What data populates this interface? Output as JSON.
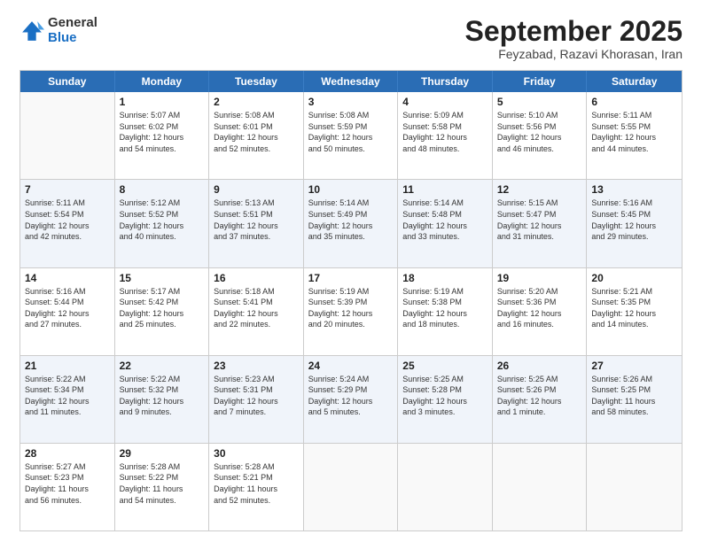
{
  "logo": {
    "general": "General",
    "blue": "Blue"
  },
  "title": "September 2025",
  "location": "Feyzabad, Razavi Khorasan, Iran",
  "header": {
    "days": [
      "Sunday",
      "Monday",
      "Tuesday",
      "Wednesday",
      "Thursday",
      "Friday",
      "Saturday"
    ]
  },
  "rows": [
    [
      {
        "day": "",
        "lines": [],
        "empty": true
      },
      {
        "day": "1",
        "lines": [
          "Sunrise: 5:07 AM",
          "Sunset: 6:02 PM",
          "Daylight: 12 hours",
          "and 54 minutes."
        ]
      },
      {
        "day": "2",
        "lines": [
          "Sunrise: 5:08 AM",
          "Sunset: 6:01 PM",
          "Daylight: 12 hours",
          "and 52 minutes."
        ]
      },
      {
        "day": "3",
        "lines": [
          "Sunrise: 5:08 AM",
          "Sunset: 5:59 PM",
          "Daylight: 12 hours",
          "and 50 minutes."
        ]
      },
      {
        "day": "4",
        "lines": [
          "Sunrise: 5:09 AM",
          "Sunset: 5:58 PM",
          "Daylight: 12 hours",
          "and 48 minutes."
        ]
      },
      {
        "day": "5",
        "lines": [
          "Sunrise: 5:10 AM",
          "Sunset: 5:56 PM",
          "Daylight: 12 hours",
          "and 46 minutes."
        ]
      },
      {
        "day": "6",
        "lines": [
          "Sunrise: 5:11 AM",
          "Sunset: 5:55 PM",
          "Daylight: 12 hours",
          "and 44 minutes."
        ]
      }
    ],
    [
      {
        "day": "7",
        "lines": [
          "Sunrise: 5:11 AM",
          "Sunset: 5:54 PM",
          "Daylight: 12 hours",
          "and 42 minutes."
        ]
      },
      {
        "day": "8",
        "lines": [
          "Sunrise: 5:12 AM",
          "Sunset: 5:52 PM",
          "Daylight: 12 hours",
          "and 40 minutes."
        ]
      },
      {
        "day": "9",
        "lines": [
          "Sunrise: 5:13 AM",
          "Sunset: 5:51 PM",
          "Daylight: 12 hours",
          "and 37 minutes."
        ]
      },
      {
        "day": "10",
        "lines": [
          "Sunrise: 5:14 AM",
          "Sunset: 5:49 PM",
          "Daylight: 12 hours",
          "and 35 minutes."
        ]
      },
      {
        "day": "11",
        "lines": [
          "Sunrise: 5:14 AM",
          "Sunset: 5:48 PM",
          "Daylight: 12 hours",
          "and 33 minutes."
        ]
      },
      {
        "day": "12",
        "lines": [
          "Sunrise: 5:15 AM",
          "Sunset: 5:47 PM",
          "Daylight: 12 hours",
          "and 31 minutes."
        ]
      },
      {
        "day": "13",
        "lines": [
          "Sunrise: 5:16 AM",
          "Sunset: 5:45 PM",
          "Daylight: 12 hours",
          "and 29 minutes."
        ]
      }
    ],
    [
      {
        "day": "14",
        "lines": [
          "Sunrise: 5:16 AM",
          "Sunset: 5:44 PM",
          "Daylight: 12 hours",
          "and 27 minutes."
        ]
      },
      {
        "day": "15",
        "lines": [
          "Sunrise: 5:17 AM",
          "Sunset: 5:42 PM",
          "Daylight: 12 hours",
          "and 25 minutes."
        ]
      },
      {
        "day": "16",
        "lines": [
          "Sunrise: 5:18 AM",
          "Sunset: 5:41 PM",
          "Daylight: 12 hours",
          "and 22 minutes."
        ]
      },
      {
        "day": "17",
        "lines": [
          "Sunrise: 5:19 AM",
          "Sunset: 5:39 PM",
          "Daylight: 12 hours",
          "and 20 minutes."
        ]
      },
      {
        "day": "18",
        "lines": [
          "Sunrise: 5:19 AM",
          "Sunset: 5:38 PM",
          "Daylight: 12 hours",
          "and 18 minutes."
        ]
      },
      {
        "day": "19",
        "lines": [
          "Sunrise: 5:20 AM",
          "Sunset: 5:36 PM",
          "Daylight: 12 hours",
          "and 16 minutes."
        ]
      },
      {
        "day": "20",
        "lines": [
          "Sunrise: 5:21 AM",
          "Sunset: 5:35 PM",
          "Daylight: 12 hours",
          "and 14 minutes."
        ]
      }
    ],
    [
      {
        "day": "21",
        "lines": [
          "Sunrise: 5:22 AM",
          "Sunset: 5:34 PM",
          "Daylight: 12 hours",
          "and 11 minutes."
        ]
      },
      {
        "day": "22",
        "lines": [
          "Sunrise: 5:22 AM",
          "Sunset: 5:32 PM",
          "Daylight: 12 hours",
          "and 9 minutes."
        ]
      },
      {
        "day": "23",
        "lines": [
          "Sunrise: 5:23 AM",
          "Sunset: 5:31 PM",
          "Daylight: 12 hours",
          "and 7 minutes."
        ]
      },
      {
        "day": "24",
        "lines": [
          "Sunrise: 5:24 AM",
          "Sunset: 5:29 PM",
          "Daylight: 12 hours",
          "and 5 minutes."
        ]
      },
      {
        "day": "25",
        "lines": [
          "Sunrise: 5:25 AM",
          "Sunset: 5:28 PM",
          "Daylight: 12 hours",
          "and 3 minutes."
        ]
      },
      {
        "day": "26",
        "lines": [
          "Sunrise: 5:25 AM",
          "Sunset: 5:26 PM",
          "Daylight: 12 hours",
          "and 1 minute."
        ]
      },
      {
        "day": "27",
        "lines": [
          "Sunrise: 5:26 AM",
          "Sunset: 5:25 PM",
          "Daylight: 11 hours",
          "and 58 minutes."
        ]
      }
    ],
    [
      {
        "day": "28",
        "lines": [
          "Sunrise: 5:27 AM",
          "Sunset: 5:23 PM",
          "Daylight: 11 hours",
          "and 56 minutes."
        ]
      },
      {
        "day": "29",
        "lines": [
          "Sunrise: 5:28 AM",
          "Sunset: 5:22 PM",
          "Daylight: 11 hours",
          "and 54 minutes."
        ]
      },
      {
        "day": "30",
        "lines": [
          "Sunrise: 5:28 AM",
          "Sunset: 5:21 PM",
          "Daylight: 11 hours",
          "and 52 minutes."
        ]
      },
      {
        "day": "",
        "lines": [],
        "empty": true
      },
      {
        "day": "",
        "lines": [],
        "empty": true
      },
      {
        "day": "",
        "lines": [],
        "empty": true
      },
      {
        "day": "",
        "lines": [],
        "empty": true
      }
    ]
  ]
}
